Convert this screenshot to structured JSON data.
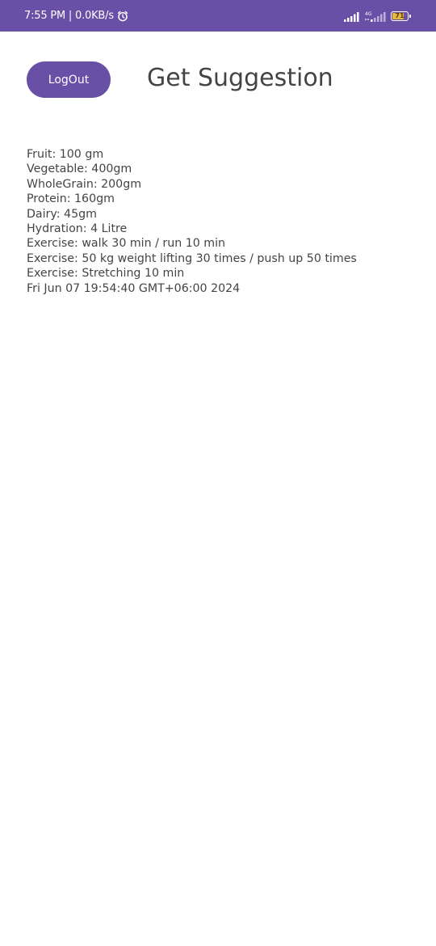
{
  "status_bar": {
    "time_speed": "7:55 PM | 0.0KB/s",
    "alarm_icon": "alarm-icon",
    "network_label": "4G",
    "battery_level": "71"
  },
  "header": {
    "logout_label": "LogOut",
    "title": "Get Suggestion"
  },
  "suggestions": [
    "Fruit: 100 gm",
    "Vegetable: 400gm",
    "WholeGrain: 200gm",
    "Protein: 160gm",
    "Dairy: 45gm",
    "Hydration: 4 Litre",
    "Exercise: walk 30 min / run 10 min",
    "Exercise: 50 kg weight lifting 30 times / push up 50 times",
    "Exercise: Stretching 10 min",
    "Fri Jun 07 19:54:40 GMT+06:00 2024"
  ],
  "colors": {
    "accent": "#6a4fa6",
    "text": "#444444",
    "battery": "#e7b83f"
  }
}
